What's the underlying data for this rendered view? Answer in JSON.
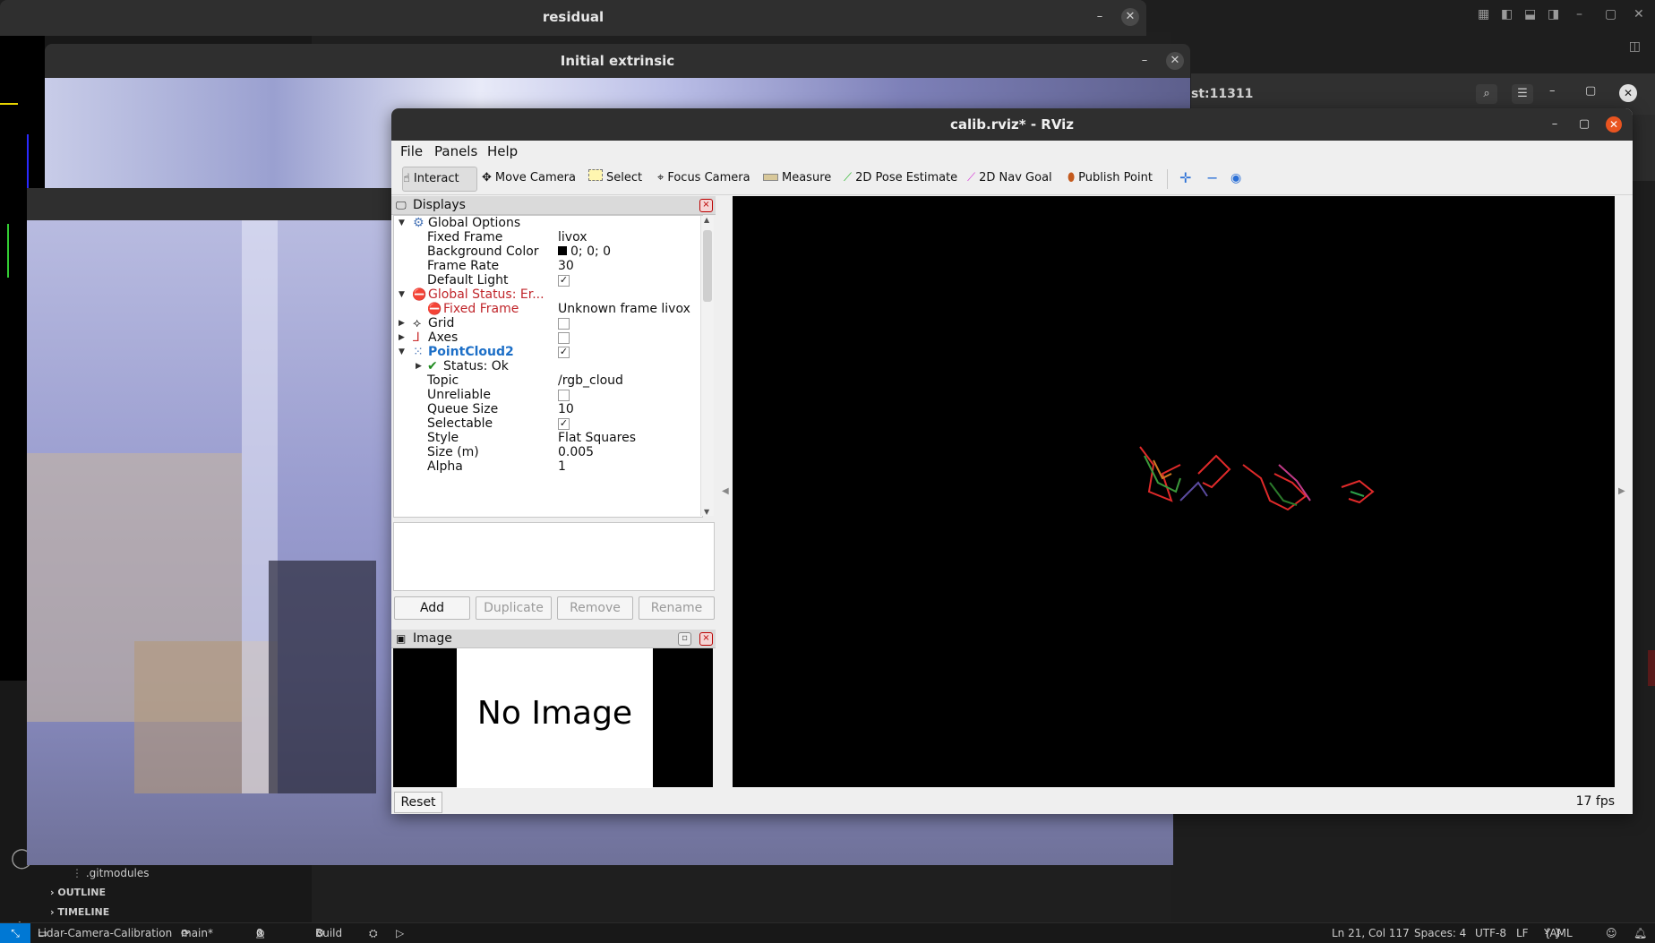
{
  "colors": {
    "rviz_close": "#e95420",
    "error_text": "#c0262b",
    "selected_display_text": "#1d6fc7",
    "viewport_background": "#000000",
    "statusbar_remote": "#0078d4"
  },
  "vscode": {
    "terminal_title": "st:11311",
    "sidebar": {
      "file_item": ".gitmodules",
      "outline_label": "OUTLINE",
      "timeline_label": "TIMELINE"
    },
    "statusbar": {
      "remote_icon": "remote-icon",
      "project": "Lidar-Camera-Calibration",
      "branch": "main*",
      "problems_errors": "0",
      "problems_warnings": "0",
      "build": "Build",
      "cursor": "Ln 21, Col 117",
      "spaces": "Spaces: 4",
      "encoding": "UTF-8",
      "eol": "LF",
      "language": "YAML"
    }
  },
  "windows": {
    "residual_title": "residual",
    "initial_extrinsic_title": "Initial extrinsic"
  },
  "rviz": {
    "title": "calib.rviz* - RViz",
    "menu": [
      "File",
      "Panels",
      "Help"
    ],
    "tools": [
      {
        "label": "Interact",
        "icon": "cursor-icon"
      },
      {
        "label": "Move Camera",
        "icon": "move-camera-icon"
      },
      {
        "label": "Select",
        "icon": "select-icon"
      },
      {
        "label": "Focus Camera",
        "icon": "focus-camera-icon"
      },
      {
        "label": "Measure",
        "icon": "measure-icon"
      },
      {
        "label": "2D Pose Estimate",
        "icon": "pose-estimate-icon"
      },
      {
        "label": "2D Nav Goal",
        "icon": "nav-goal-icon"
      },
      {
        "label": "Publish Point",
        "icon": "publish-point-icon"
      }
    ],
    "displays": {
      "header": "Displays",
      "rows": {
        "global_options": "Global Options",
        "fixed_frame_label": "Fixed Frame",
        "fixed_frame_value": "livox",
        "bg_color_label": "Background Color",
        "bg_color_value": "0; 0; 0",
        "frame_rate_label": "Frame Rate",
        "frame_rate_value": "30",
        "default_light_label": "Default Light",
        "global_status_label": "Global Status: Er...",
        "global_status_fixed_frame_label": "Fixed Frame",
        "global_status_fixed_frame_value": "Unknown frame livox",
        "grid_label": "Grid",
        "axes_label": "Axes",
        "pointcloud_label": "PointCloud2",
        "status_ok_label": "Status: Ok",
        "topic_label": "Topic",
        "topic_value": "/rgb_cloud",
        "unreliable_label": "Unreliable",
        "queue_size_label": "Queue Size",
        "queue_size_value": "10",
        "selectable_label": "Selectable",
        "style_label": "Style",
        "style_value": "Flat Squares",
        "size_label": "Size (m)",
        "size_value": "0.005",
        "alpha_label": "Alpha",
        "alpha_value": "1"
      },
      "checkboxes": {
        "default_light": true,
        "grid": false,
        "axes": false,
        "pointcloud2": true,
        "unreliable": false,
        "selectable": true
      },
      "buttons": {
        "add": "Add",
        "duplicate": "Duplicate",
        "remove": "Remove",
        "rename": "Rename"
      }
    },
    "image_panel": {
      "header": "Image",
      "placeholder": "No Image"
    },
    "reset_label": "Reset",
    "fps": "17 fps"
  }
}
